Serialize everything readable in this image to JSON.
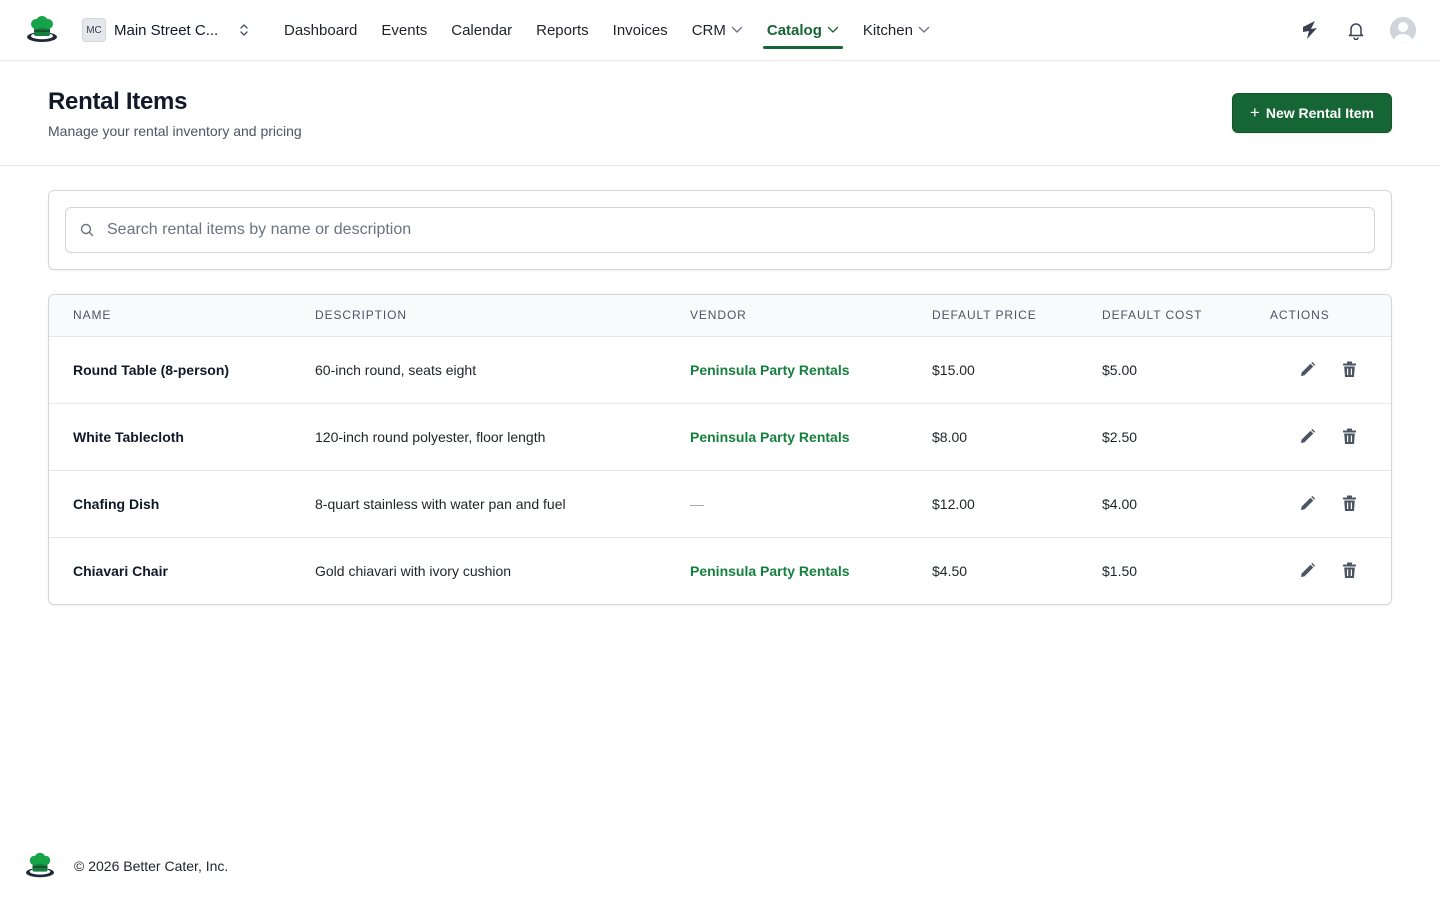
{
  "brand": {
    "logo_icon": "chef-hat-icon",
    "accent_color": "#166534"
  },
  "org_switcher": {
    "initials": "MC",
    "name": "Main Street C...",
    "icon": "chevron-up-down-icon"
  },
  "nav": {
    "items": [
      {
        "label": "Dashboard",
        "has_dropdown": false,
        "active": false
      },
      {
        "label": "Events",
        "has_dropdown": false,
        "active": false
      },
      {
        "label": "Calendar",
        "has_dropdown": false,
        "active": false
      },
      {
        "label": "Reports",
        "has_dropdown": false,
        "active": false
      },
      {
        "label": "Invoices",
        "has_dropdown": false,
        "active": false
      },
      {
        "label": "CRM",
        "has_dropdown": true,
        "active": false
      },
      {
        "label": "Catalog",
        "has_dropdown": true,
        "active": true
      },
      {
        "label": "Kitchen",
        "has_dropdown": true,
        "active": false
      }
    ]
  },
  "topbar_right": {
    "icons": [
      "announcement-icon",
      "bell-icon",
      "user-avatar-icon"
    ]
  },
  "header": {
    "title": "Rental Items",
    "subtitle": "Manage your rental inventory and pricing",
    "new_button_label": "New Rental Item"
  },
  "search": {
    "placeholder": "Search rental items by name or description",
    "value": ""
  },
  "table": {
    "columns": [
      "NAME",
      "DESCRIPTION",
      "VENDOR",
      "DEFAULT PRICE",
      "DEFAULT COST",
      "ACTIONS"
    ],
    "rows": [
      {
        "name": "Round Table (8-person)",
        "description": "60-inch round, seats eight",
        "vendor": "Peninsula Party Rentals",
        "price": "$15.00",
        "cost": "$5.00"
      },
      {
        "name": "White Tablecloth",
        "description": "120-inch round polyester, floor length",
        "vendor": "Peninsula Party Rentals",
        "price": "$8.00",
        "cost": "$2.50"
      },
      {
        "name": "Chafing Dish",
        "description": "8-quart stainless with water pan and fuel",
        "vendor": "—",
        "price": "$12.00",
        "cost": "$4.00"
      },
      {
        "name": "Chiavari Chair",
        "description": "Gold chiavari with ivory cushion",
        "vendor": "Peninsula Party Rentals",
        "price": "$4.50",
        "cost": "$1.50"
      }
    ]
  },
  "footer": {
    "text": "© 2026 Better Cater, Inc."
  }
}
